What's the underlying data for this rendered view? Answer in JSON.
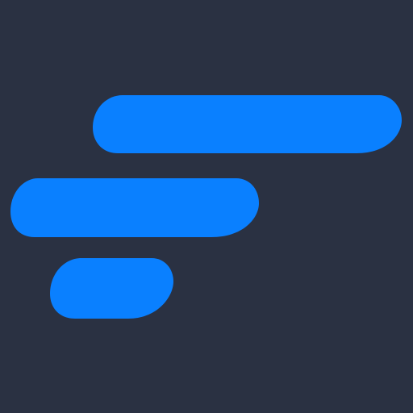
{
  "icon": {
    "semantic": "logo-icon",
    "bars_count": 3
  },
  "colors": {
    "background": "#2a3142",
    "accent": "#0a80ff"
  }
}
